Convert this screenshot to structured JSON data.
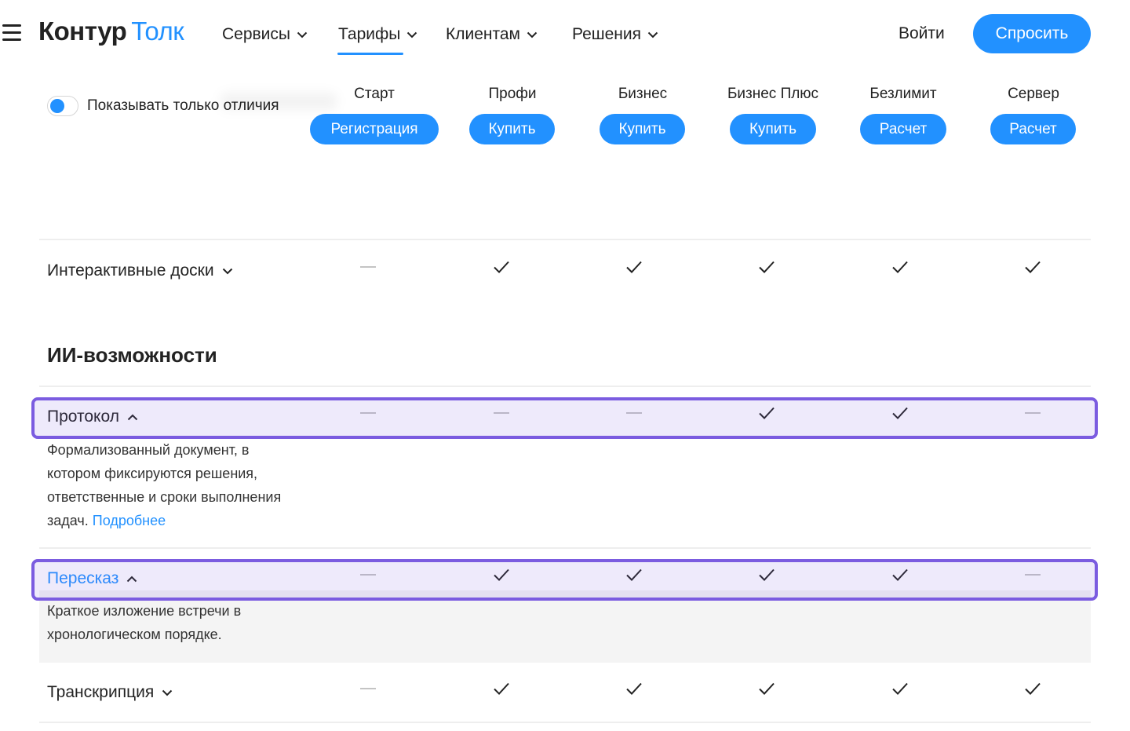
{
  "header": {
    "menu_icon": "hamburger-icon",
    "logo_part1": "Контур",
    "logo_part2": "Толк",
    "nav": [
      {
        "label": "Сервисы"
      },
      {
        "label": "Тарифы"
      },
      {
        "label": "Клиентам"
      },
      {
        "label": "Решения"
      }
    ],
    "login": "Войти",
    "ask_button": "Спросить"
  },
  "colors": {
    "accent": "#2291ff",
    "highlight": "#7b5ce0",
    "text": "#222222"
  },
  "filter": {
    "toggle_on": true,
    "label": "Показывать только отличия"
  },
  "plans": [
    {
      "name": "Старт",
      "button": "Регистрация"
    },
    {
      "name": "Профи",
      "button": "Купить"
    },
    {
      "name": "Бизнес",
      "button": "Купить"
    },
    {
      "name": "Бизнес Плюс",
      "button": "Купить"
    },
    {
      "name": "Безлимит",
      "button": "Расчет"
    },
    {
      "name": "Сервер",
      "button": "Расчет"
    }
  ],
  "features": {
    "boards": {
      "label": "Интерактивные доски",
      "values": [
        "dash",
        "check",
        "check",
        "check",
        "check",
        "check"
      ]
    },
    "ai_section_title": "ИИ-возможности",
    "protocol": {
      "label": "Протокол",
      "values": [
        "dash",
        "dash",
        "dash",
        "check",
        "check",
        "dash"
      ],
      "description": "Формализованный документ, в котором фиксируются решения, ответственные и сроки выполнения задач.",
      "more_link": "Подробнее"
    },
    "retelling": {
      "label": "Пересказ",
      "values": [
        "dash",
        "check",
        "check",
        "check",
        "check",
        "dash"
      ],
      "description": "Краткое изложение встречи в хронологическом порядке."
    },
    "transcription": {
      "label": "Транскрипция",
      "values": [
        "dash",
        "check",
        "check",
        "check",
        "check",
        "check"
      ]
    }
  }
}
